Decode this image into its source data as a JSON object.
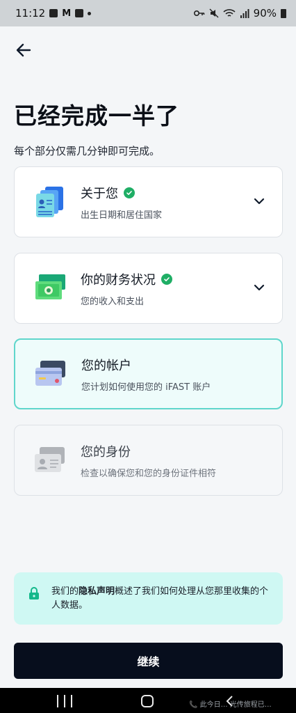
{
  "status_bar": {
    "time": "11:12",
    "left_icons": [
      "gallery-icon",
      "gmail-icon",
      "checkbox-icon",
      "dot-icon"
    ],
    "right_icons": [
      "key-icon",
      "mute-icon",
      "wifi-icon",
      "signal-icon"
    ],
    "battery": "90%"
  },
  "header": {
    "back_icon": "arrow-left-icon",
    "title": "已经完成一半了",
    "subtitle": "每个部分仅需几分钟即可完成。"
  },
  "sections": [
    {
      "title": "关于您",
      "description": "出生日期和居住国家",
      "completed": true,
      "state": "completed",
      "icon": "documents-icon"
    },
    {
      "title": "你的财务状况",
      "description": "您的收入和支出",
      "completed": true,
      "state": "completed",
      "icon": "money-icon"
    },
    {
      "title": "您的帐户",
      "description": "您计划如何使用您的 iFAST 账户",
      "completed": false,
      "state": "active",
      "icon": "card-icon"
    },
    {
      "title": "您的身份",
      "description": "检查以确保您和您的身份证件相符",
      "completed": false,
      "state": "disabled",
      "icon": "id-card-icon"
    }
  ],
  "privacy": {
    "prefix": "我们的",
    "link": "隐私声明",
    "suffix": "概述了我们如何处理从您那里收集的个人数据。",
    "icon": "lock-icon"
  },
  "continue_label": "继续",
  "nav_overlay_text": "📞 此今日… 光传旅程已…",
  "colors": {
    "accent": "#5fd6cb",
    "success": "#1fae65",
    "button": "#070e1d",
    "privacy_bg": "#cff8f3"
  }
}
